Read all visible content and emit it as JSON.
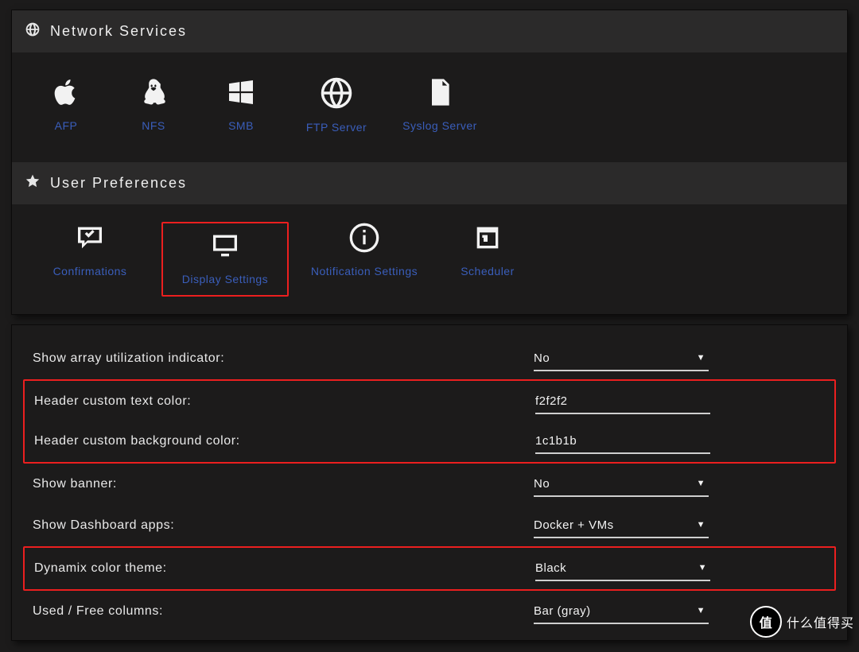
{
  "sections": {
    "network": {
      "title": "Network Services",
      "items": [
        {
          "label": "AFP"
        },
        {
          "label": "NFS"
        },
        {
          "label": "SMB"
        },
        {
          "label": "FTP Server"
        },
        {
          "label": "Syslog Server"
        }
      ]
    },
    "prefs": {
      "title": "User Preferences",
      "items": [
        {
          "label": "Confirmations"
        },
        {
          "label": "Display Settings"
        },
        {
          "label": "Notification Settings"
        },
        {
          "label": "Scheduler"
        }
      ]
    }
  },
  "settings": {
    "rows": [
      {
        "label": "Show array utilization indicator:",
        "value": "No",
        "type": "select"
      },
      {
        "label": "Header custom text color:",
        "value": "f2f2f2",
        "type": "text"
      },
      {
        "label": "Header custom background color:",
        "value": "1c1b1b",
        "type": "text"
      },
      {
        "label": "Show banner:",
        "value": "No",
        "type": "select"
      },
      {
        "label": "Show Dashboard apps:",
        "value": "Docker + VMs",
        "type": "select"
      },
      {
        "label": "Dynamix color theme:",
        "value": "Black",
        "type": "select"
      },
      {
        "label": "Used / Free columns:",
        "value": "Bar (gray)",
        "type": "select"
      }
    ]
  },
  "watermark": {
    "badge": "值",
    "text": "什么值得买"
  }
}
